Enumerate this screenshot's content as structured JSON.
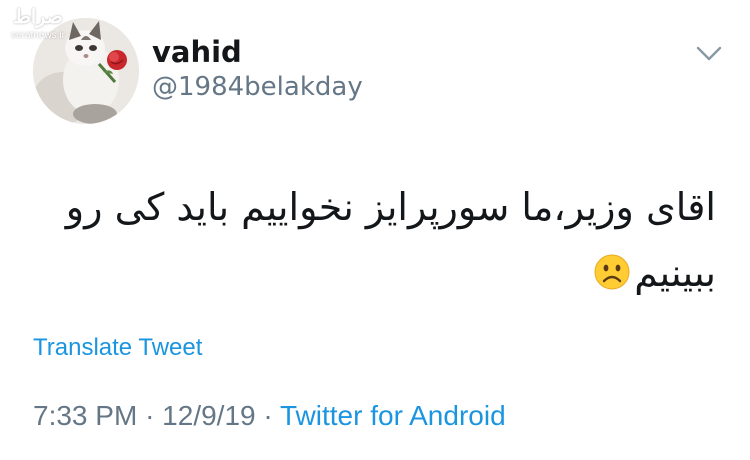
{
  "watermark": {
    "logo": "صراط",
    "site": "seratnews.ir"
  },
  "user": {
    "display_name": "vahid",
    "handle": "@1984belakday",
    "avatar_icon": "cat-with-rose-avatar"
  },
  "menu": {
    "icon": "chevron-down-icon"
  },
  "tweet": {
    "text_line_1": "اقای وزیر،ما سورپرایز نخواییم باید کی رو",
    "text_line_2": "ببینیم",
    "emoji": "frowning-face-emoji"
  },
  "actions": {
    "translate_label": "Translate Tweet"
  },
  "meta": {
    "time": "7:33 PM",
    "separator": "·",
    "date": "12/9/19",
    "source": "Twitter for Android"
  },
  "colors": {
    "text_primary": "#14171a",
    "text_secondary": "#657786",
    "link": "#1b95e0",
    "background": "#ffffff",
    "emoji_face": "#ffcc33"
  }
}
